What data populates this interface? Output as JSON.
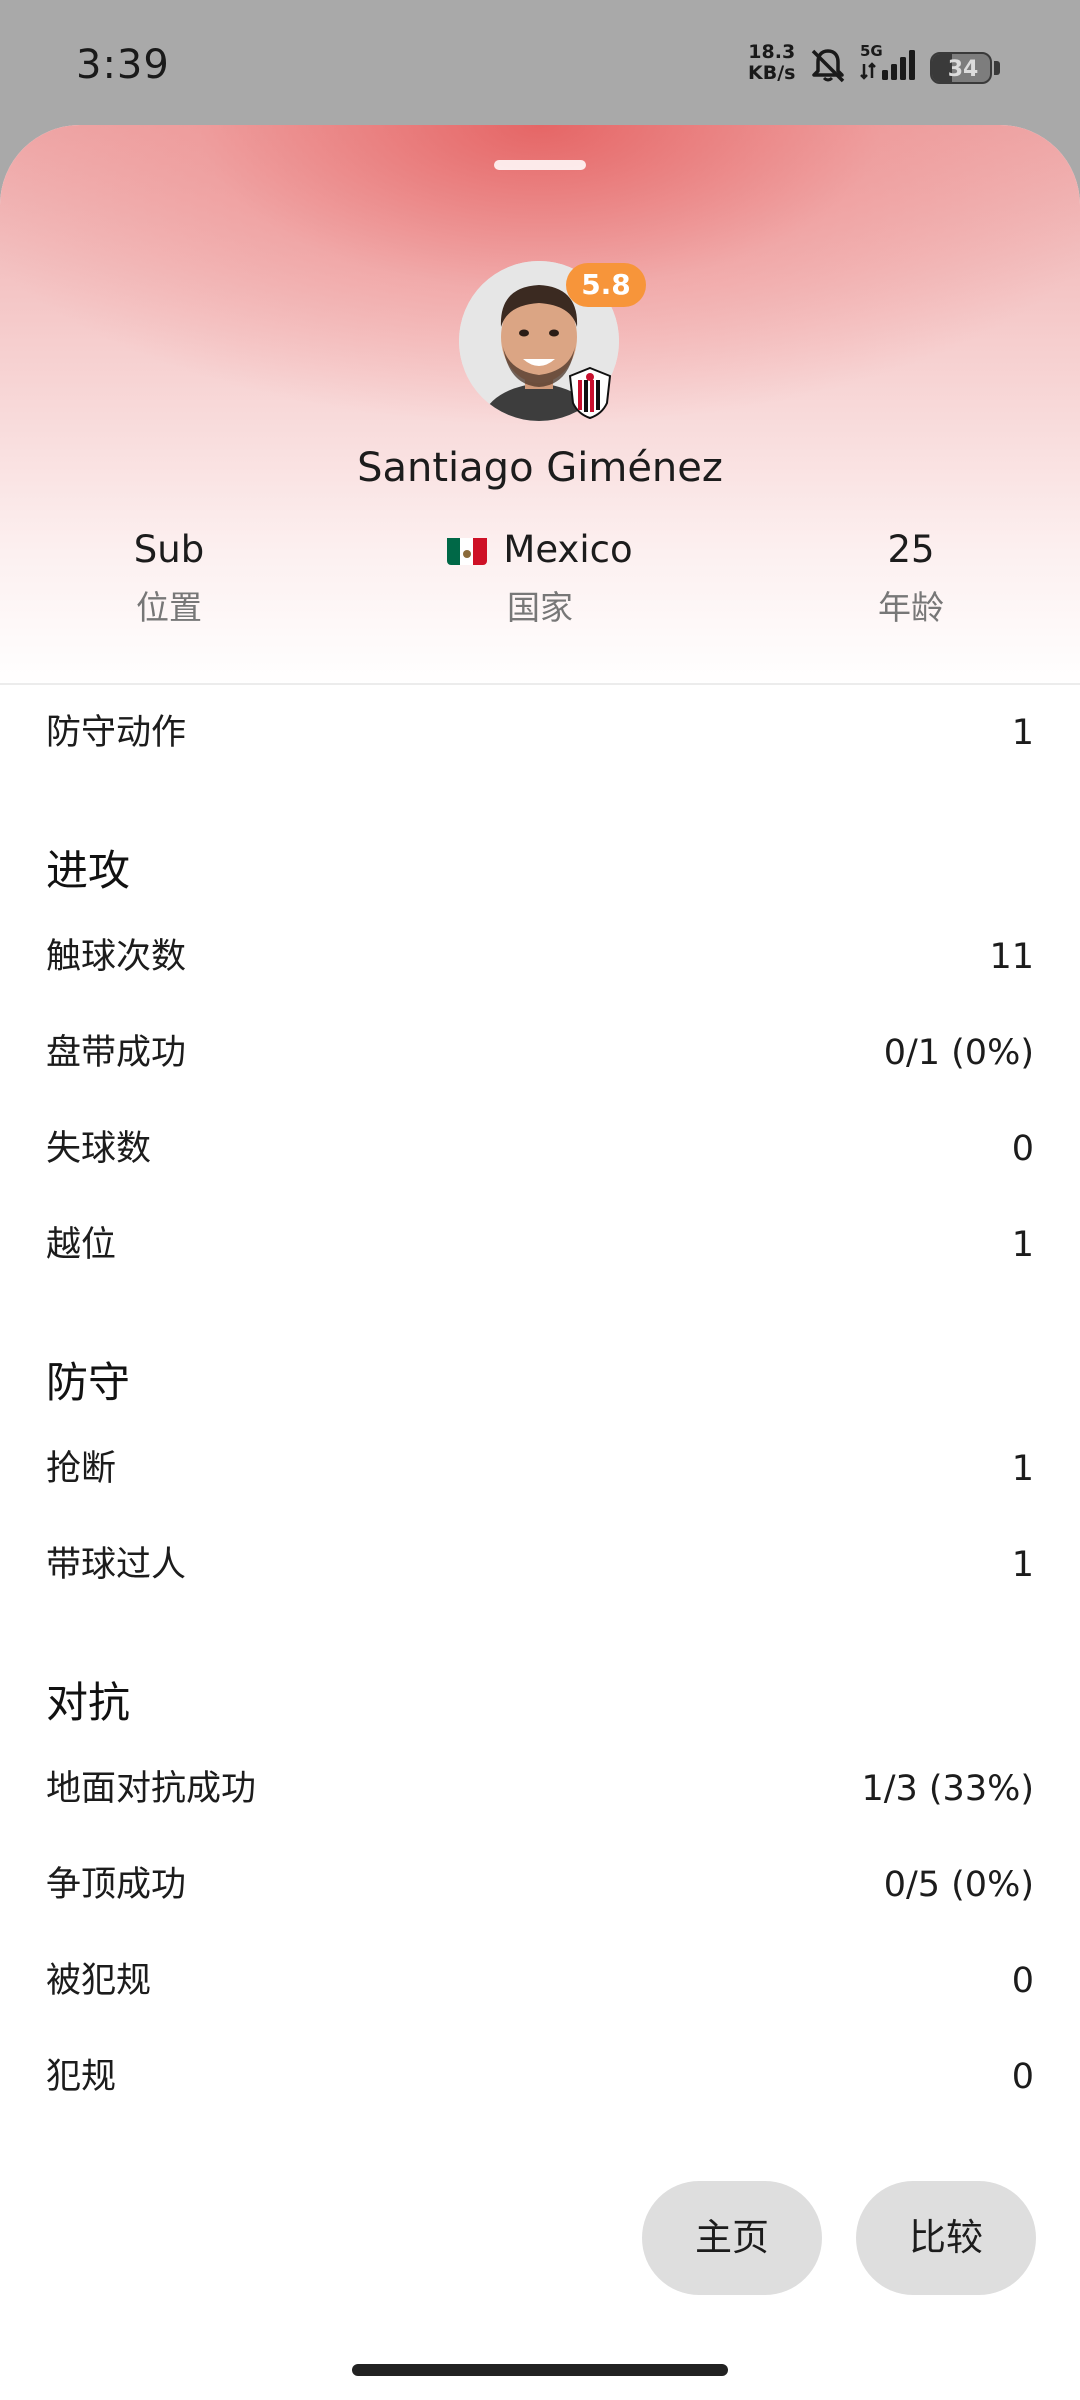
{
  "status_bar": {
    "time": "3:39",
    "net_speed_value": "18.3",
    "net_speed_unit": "KB/s",
    "network": "5G",
    "battery": "34",
    "battery_level": 0.34,
    "icons": [
      "bell-muted-icon",
      "signal-icon",
      "battery-icon"
    ]
  },
  "player": {
    "name": "Santiago Giménez",
    "rating": "5.8",
    "rating_color": "#f7953a",
    "club_badge": "ac-milan-crest",
    "position_value": "Sub",
    "position_label": "位置",
    "country_value": "Mexico",
    "country_label": "国家",
    "country_flag": "mexico-flag-icon",
    "age_value": "25",
    "age_label": "年龄"
  },
  "stats": {
    "defensive_actions": {
      "label": "防守动作",
      "value": "1"
    },
    "attack": {
      "title": "进攻",
      "rows": [
        {
          "label": "触球次数",
          "value": "11"
        },
        {
          "label": "盘带成功",
          "value": "0/1 (0%)"
        },
        {
          "label": "失球数",
          "value": "0"
        },
        {
          "label": "越位",
          "value": "1"
        }
      ]
    },
    "defense": {
      "title": "防守",
      "rows": [
        {
          "label": "抢断",
          "value": "1"
        },
        {
          "label": "带球过人",
          "value": "1"
        }
      ]
    },
    "duels": {
      "title": "对抗",
      "rows": [
        {
          "label": "地面对抗成功",
          "value": "1/3 (33%)"
        },
        {
          "label": "争顶成功",
          "value": "0/5 (0%)"
        },
        {
          "label": "被犯规",
          "value": "0"
        },
        {
          "label": "犯规",
          "value": "0"
        }
      ]
    }
  },
  "buttons": {
    "home": "主页",
    "compare": "比较"
  },
  "colors": {
    "header_accent": "#e45a5a",
    "button_bg": "#dedede"
  }
}
